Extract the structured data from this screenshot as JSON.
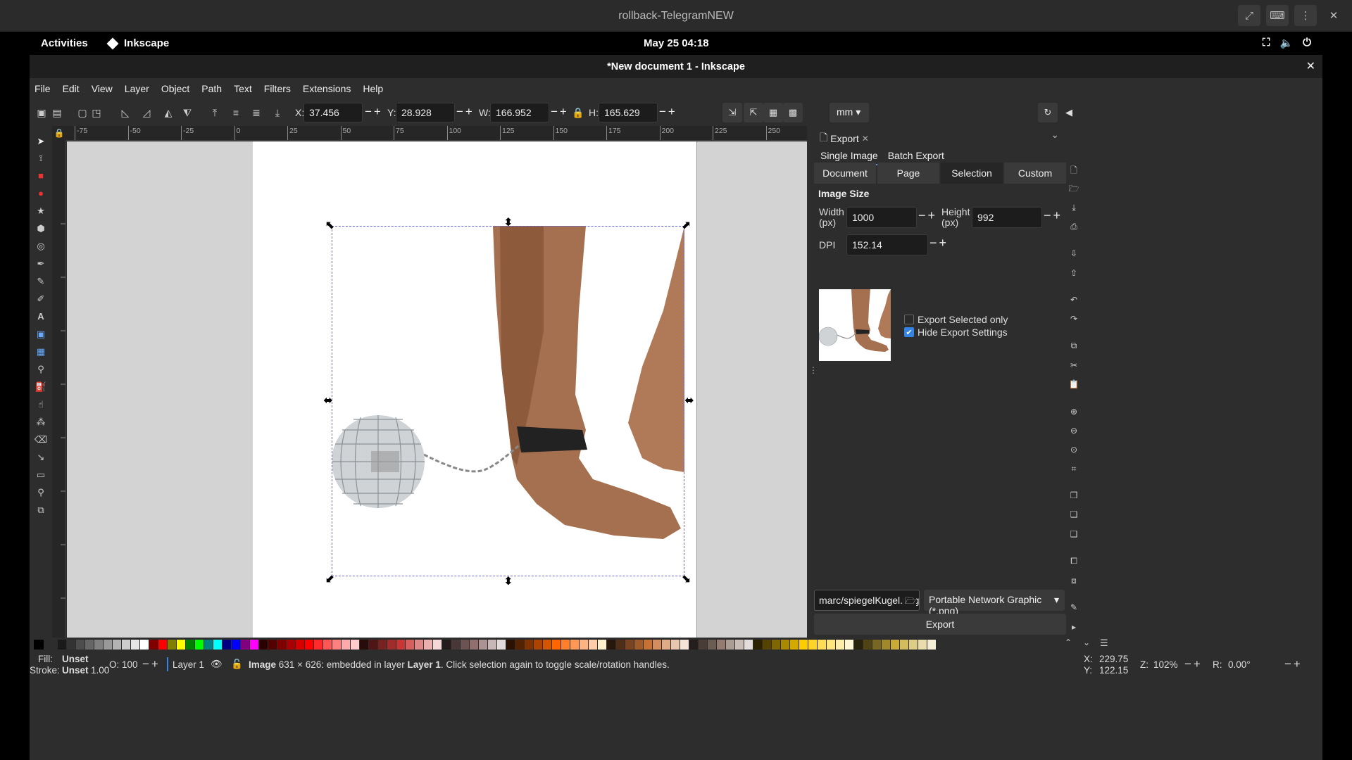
{
  "vm_window": {
    "title": "rollback-TelegramNEW"
  },
  "gnome": {
    "activities": "Activities",
    "app_name": "Inkscape",
    "clock": "May 25  04:18"
  },
  "inkscape": {
    "title": "*New document 1 - Inkscape",
    "menu": [
      "File",
      "Edit",
      "View",
      "Layer",
      "Object",
      "Path",
      "Text",
      "Filters",
      "Extensions",
      "Help"
    ],
    "toolbar": {
      "x_label": "X:",
      "x_value": "37.456",
      "y_label": "Y:",
      "y_value": "28.928",
      "w_label": "W:",
      "w_value": "166.952",
      "h_label": "H:",
      "h_value": "165.629",
      "unit": "mm"
    },
    "ruler_labels": [
      "-75",
      "-50",
      "-25",
      "0",
      "25",
      "50",
      "75",
      "100",
      "125",
      "150",
      "175",
      "200",
      "225",
      "250"
    ],
    "export": {
      "tab_label": "Export",
      "subtabs": [
        "Single Image",
        "Batch Export"
      ],
      "area_buttons": [
        "Document",
        "Page",
        "Selection",
        "Custom"
      ],
      "active_area": "Selection",
      "image_size_title": "Image Size",
      "width_label": "Width\n(px)",
      "width_value": "1000",
      "height_label": "Height\n(px)",
      "height_value": "992",
      "dpi_label": "DPI",
      "dpi_value": "152.14",
      "export_selected_only": "Export Selected only",
      "export_selected_checked": false,
      "hide_export_settings": "Hide Export Settings",
      "hide_export_checked": true,
      "filename": "marc/spiegelKugel.png",
      "filetype": "Portable Network Graphic (*.png)",
      "export_button": "Export"
    },
    "status": {
      "fill_label": "Fill:",
      "fill_value": "Unset",
      "stroke_label": "Stroke:",
      "stroke_value": "Unset",
      "stroke_width": "1.00",
      "opacity_label": "O:",
      "opacity_value": "100",
      "layer": "Layer 1",
      "message_bold": "Image",
      "message_rest": " 631 × 626: embedded in layer ",
      "message_layer": "Layer 1",
      "message_tail": ". Click selection again to toggle scale/rotation handles.",
      "cursor_x_label": "X:",
      "cursor_x": "229.75",
      "cursor_y_label": "Y:",
      "cursor_y": "122.15",
      "zoom_label": "Z:",
      "zoom": "102%",
      "rotation_label": "R:",
      "rotation": "0.00°"
    },
    "colors": {
      "selection_dash": "#6a6ad8",
      "accent": "#3584e4"
    }
  }
}
